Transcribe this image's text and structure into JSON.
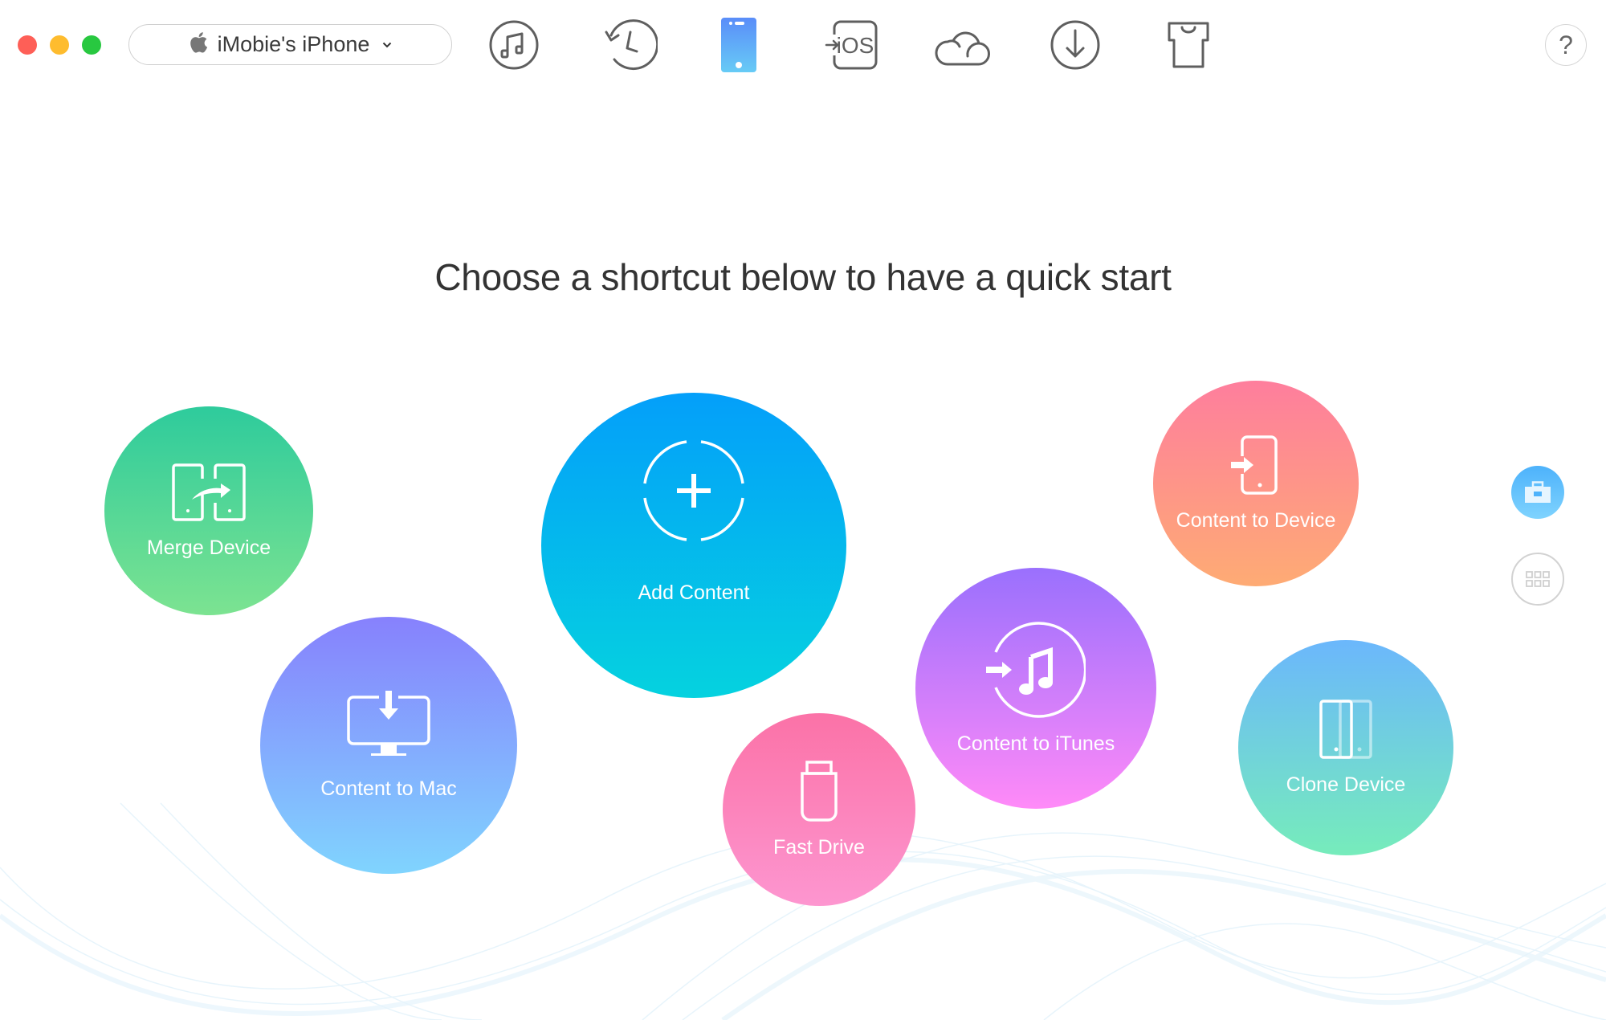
{
  "window": {
    "traffic_lights": [
      {
        "name": "close",
        "color": "#fe5f57"
      },
      {
        "name": "minimize",
        "color": "#febc2e"
      },
      {
        "name": "zoom",
        "color": "#28c840"
      }
    ]
  },
  "header": {
    "device_selector": {
      "label": "iMobie's iPhone",
      "icon": "apple-icon"
    },
    "toolbar": [
      {
        "name": "itunes-library",
        "icon": "music-note-icon",
        "active": false
      },
      {
        "name": "backup-history",
        "icon": "history-clock-icon",
        "active": false
      },
      {
        "name": "device-manager",
        "icon": "iphone-icon",
        "active": true
      },
      {
        "name": "ios-mover",
        "icon": "to-ios-icon",
        "text": "iOS",
        "active": false
      },
      {
        "name": "icloud",
        "icon": "cloud-icon",
        "active": false
      },
      {
        "name": "downloader",
        "icon": "download-circle-icon",
        "active": false
      },
      {
        "name": "ringtone-maker",
        "icon": "tshirt-icon",
        "active": false
      }
    ],
    "help_label": "?"
  },
  "main": {
    "headline": "Choose a shortcut below to have a quick start",
    "shortcuts": [
      {
        "id": "merge-device",
        "label": "Merge Device",
        "icon": "merge-device-icon",
        "colors": [
          "#2ecb9c",
          "#7ce391"
        ]
      },
      {
        "id": "content-to-mac",
        "label": "Content to Mac",
        "icon": "computer-download-icon",
        "colors": [
          "#8781fd",
          "#80d4fe"
        ]
      },
      {
        "id": "add-content",
        "label": "Add Content",
        "icon": "add-plus-icon",
        "colors": [
          "#049ffa",
          "#05d2df"
        ]
      },
      {
        "id": "fast-drive",
        "label": "Fast Drive",
        "icon": "usb-drive-icon",
        "colors": [
          "#fb72a7",
          "#fd96d0"
        ]
      },
      {
        "id": "content-to-itunes",
        "label": "Content to iTunes",
        "icon": "itunes-import-icon",
        "colors": [
          "#9a70fd",
          "#ff8af8"
        ]
      },
      {
        "id": "content-to-device",
        "label": "Content to Device",
        "icon": "phone-import-icon",
        "colors": [
          "#fe7e9d",
          "#feab74"
        ]
      },
      {
        "id": "clone-device",
        "label": "Clone Device",
        "icon": "clone-device-icon",
        "colors": [
          "#6bb7fc",
          "#76ecbb"
        ]
      }
    ]
  },
  "side_panel": {
    "buttons": [
      {
        "name": "toolkit",
        "icon": "briefcase-icon",
        "active": true
      },
      {
        "name": "category-view",
        "icon": "grid-icon",
        "active": false
      }
    ]
  },
  "accent_color": "#55b4fb"
}
